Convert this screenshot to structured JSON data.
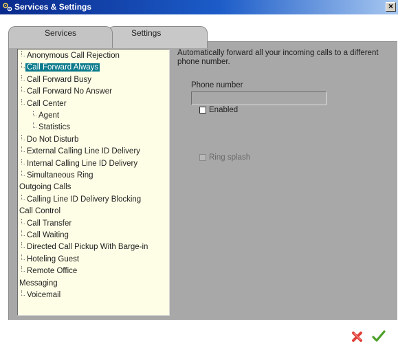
{
  "window": {
    "title": "Services & Settings"
  },
  "tabs": [
    {
      "label": "Services",
      "active": true
    },
    {
      "label": "Settings",
      "active": false
    }
  ],
  "tree": {
    "items": [
      {
        "label": "Anonymous Call Rejection",
        "level": 1
      },
      {
        "label": "Call Forward Always",
        "level": 1,
        "selected": true
      },
      {
        "label": "Call Forward Busy",
        "level": 1
      },
      {
        "label": "Call Forward No Answer",
        "level": 1
      },
      {
        "label": "Call Center",
        "level": 1
      },
      {
        "label": "Agent",
        "level": 2
      },
      {
        "label": "Statistics",
        "level": 2
      },
      {
        "label": "Do Not Disturb",
        "level": 1
      },
      {
        "label": "External Calling Line ID Delivery",
        "level": 1
      },
      {
        "label": "Internal Calling Line ID Delivery",
        "level": 1
      },
      {
        "label": "Simultaneous Ring",
        "level": 1
      },
      {
        "label": "Outgoing Calls",
        "level": 0
      },
      {
        "label": "Calling Line ID Delivery Blocking",
        "level": 1
      },
      {
        "label": "Call Control",
        "level": 0
      },
      {
        "label": "Call Transfer",
        "level": 1
      },
      {
        "label": "Call Waiting",
        "level": 1
      },
      {
        "label": "Directed Call Pickup With Barge-in",
        "level": 1
      },
      {
        "label": "Hoteling Guest",
        "level": 1
      },
      {
        "label": "Remote Office",
        "level": 1
      },
      {
        "label": "Messaging",
        "level": 0
      },
      {
        "label": "Voicemail",
        "level": 1
      }
    ]
  },
  "detail": {
    "description": "Automatically forward all your incoming calls to a different phone number.",
    "enabled_label": "Enabled",
    "enabled_checked": false,
    "phone_label": "Phone number",
    "phone_value": "",
    "ring_splash_label": "Ring splash",
    "ring_splash_checked": false,
    "ring_splash_disabled": true
  },
  "icons": {
    "title": "gears-icon",
    "close": "close-icon",
    "cancel": "cancel-x-icon",
    "ok": "checkmark-icon"
  },
  "colors": {
    "titlebar": "#0a2a8c",
    "selection": "#0a7a8c",
    "tree_background": "#fefee6",
    "panel_background": "#a8a8a8",
    "cancel": "#e0403a",
    "ok": "#4ca02a"
  }
}
